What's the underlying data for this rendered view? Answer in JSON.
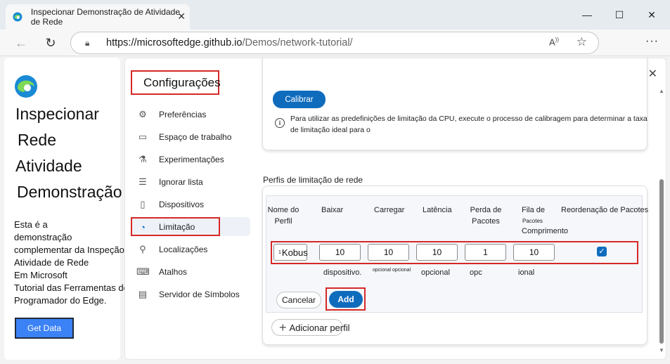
{
  "browser": {
    "tab_title": "Inspecionar Demonstração de Atividade de Rede",
    "url_host": "https://microsoftedge.github.io",
    "url_path": "/Demos/network-tutorial/",
    "window_buttons": {
      "minimize": "—",
      "maximize": "☐",
      "close": "✕"
    },
    "read_aloud": "A)",
    "more": "···"
  },
  "page": {
    "title_lines": [
      "Inspecionar",
      "Rede",
      "Atividade",
      "Demonstração"
    ],
    "text_lines": [
      "Esta é a",
      "demonstração",
      "complementar da Inspeção",
      "Atividade de Rede",
      "Em Microsoft",
      "Tutorial das Ferramentas de",
      "Programador do Edge."
    ],
    "button": "Get Data"
  },
  "settings": {
    "title": "Configurações",
    "nav": [
      {
        "label": "Preferências",
        "icon": "gear-icon",
        "glyph": "⚙"
      },
      {
        "label": "Espaço de trabalho",
        "icon": "folder-icon",
        "glyph": "🗀"
      },
      {
        "label": "Experimentações",
        "icon": "flask-icon",
        "glyph": "⚗"
      },
      {
        "label": "Ignorar lista",
        "icon": "ignore-list-icon",
        "glyph": "☰"
      },
      {
        "label": "Dispositivos",
        "icon": "devices-icon",
        "glyph": "▯"
      },
      {
        "label": "Limitação",
        "icon": "gauge-icon",
        "glyph": "◔"
      },
      {
        "label": "Localizações",
        "icon": "location-icon",
        "glyph": "⚲"
      },
      {
        "label": "Atalhos",
        "icon": "keyboard-icon",
        "glyph": "⌨"
      },
      {
        "label": "Servidor de Símbolos",
        "icon": "symbol-server-icon",
        "glyph": "▤"
      }
    ],
    "calibrate_button": "Calibrar",
    "info_text": "Para utilizar as predefinições de limitação da CPU, execute o processo de calibragem para determinar a taxa de limitação ideal para o",
    "profiles_label": "Perfis de limitação de rede",
    "columns": [
      "Nome do Perfil",
      "Baixar",
      "Carregar",
      "Latência",
      "Perda de Pacotes",
      "Fila de",
      "Pacotes",
      "Comprimento",
      "Reordenação de Pacotes"
    ],
    "row": {
      "name": "Kobus",
      "name_prefix": "1",
      "download": "10",
      "upload": "10",
      "latency": "10",
      "loss": "1",
      "queue": "10"
    },
    "hints": [
      "dispositivo.",
      "opcional opcional",
      "opcional",
      "opc",
      "ional"
    ],
    "cancel": "Cancelar",
    "add": "Add",
    "add_profile": "Adicionar perfil"
  }
}
